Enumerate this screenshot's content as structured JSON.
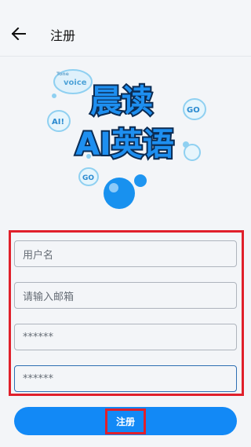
{
  "header": {
    "back_icon": "arrow-left-icon",
    "title": "注册"
  },
  "logo": {
    "line1": "晨读",
    "line2": "AI英语",
    "bubble_voice": "voice",
    "bubble_tone": "Tone",
    "bubble_ai": "AI!",
    "bubble_go": "GO",
    "bubble_go_small": "GO"
  },
  "form": {
    "username_placeholder": "用户名",
    "email_placeholder": "请输入邮箱",
    "password_value": "******",
    "confirm_password_value": "******"
  },
  "actions": {
    "register_label": "注册"
  },
  "colors": {
    "accent": "#1289f6",
    "highlight_border": "#e0202b",
    "logo_text": "#1e8ff0"
  }
}
